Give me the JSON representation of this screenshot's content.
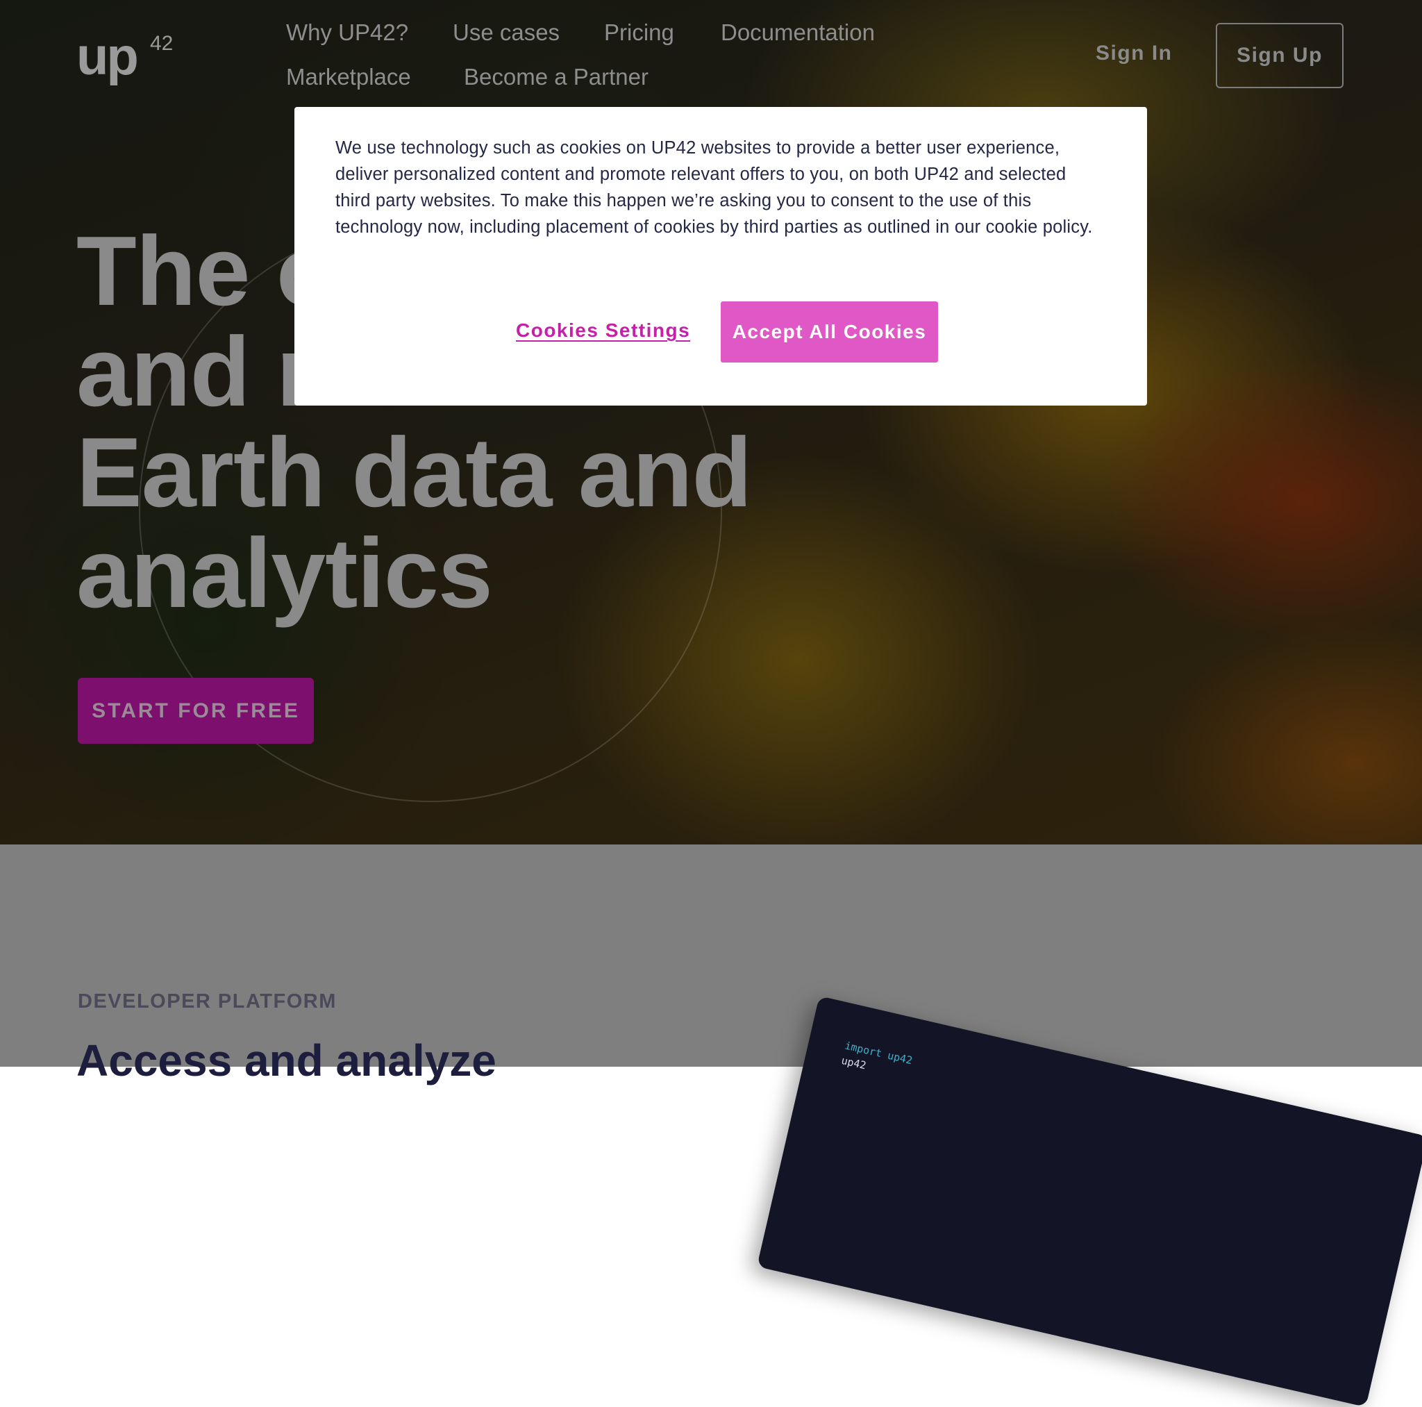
{
  "brand": {
    "logo_text": "up",
    "logo_superscript": "42"
  },
  "nav": {
    "links": [
      "Why UP42?",
      "Use cases",
      "Pricing",
      "Documentation",
      "Marketplace",
      "Become a Partner"
    ],
    "sign_in": "Sign In",
    "sign_up": "Sign Up"
  },
  "hero": {
    "headline_lines": [
      "The o",
      "and r",
      "Earth data and",
      "analytics"
    ],
    "cta_label": "START FOR FREE"
  },
  "section": {
    "eyebrow": "DEVELOPER PLATFORM",
    "title": "Access and analyze",
    "code_lines": [
      "import up42",
      "up42"
    ]
  },
  "cookie_banner": {
    "message": "We use technology such as cookies on UP42 websites to provide a better user experience, deliver personalized content and promote relevant offers to you, on both UP42 and selected third party websites. To make this happen we’re asking you to consent to the use of this technology now, including placement of cookies by third parties as outlined in our cookie policy.",
    "settings_label": "Cookies Settings",
    "accept_label": "Accept All Cookies"
  },
  "colors": {
    "accent": "#df58c6",
    "link": "#c420a8",
    "cta_dimmed": "#7d0f6e",
    "text_dark": "#242746"
  }
}
